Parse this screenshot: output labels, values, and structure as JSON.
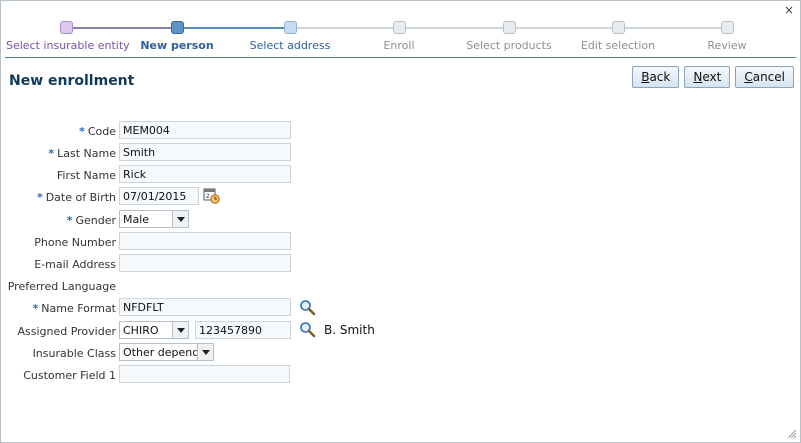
{
  "window": {
    "close_glyph": "×"
  },
  "train": {
    "steps": [
      {
        "label": "Select insurable entity",
        "state": "visited"
      },
      {
        "label": "New person",
        "state": "current"
      },
      {
        "label": "Select address",
        "state": "next"
      },
      {
        "label": "Enroll",
        "state": "pending"
      },
      {
        "label": "Select products",
        "state": "pending"
      },
      {
        "label": "Edit selection",
        "state": "pending"
      },
      {
        "label": "Review",
        "state": "pending"
      }
    ]
  },
  "page": {
    "title": "New enrollment"
  },
  "buttons": {
    "back": {
      "mnemonic": "B",
      "rest": "ack"
    },
    "next": {
      "mnemonic": "N",
      "rest": "ext"
    },
    "cancel": {
      "mnemonic": "C",
      "rest": "ancel"
    }
  },
  "form": {
    "required_marker": "*",
    "code": {
      "label": "Code",
      "value": "MEM004"
    },
    "last_name": {
      "label": "Last Name",
      "value": "Smith"
    },
    "first_name": {
      "label": "First Name",
      "value": "Rick"
    },
    "dob": {
      "label": "Date of Birth",
      "value": "07/01/2015"
    },
    "gender": {
      "label": "Gender",
      "value": "Male"
    },
    "phone": {
      "label": "Phone Number",
      "value": ""
    },
    "email": {
      "label": "E-mail Address",
      "value": ""
    },
    "language": {
      "label": "Preferred Language"
    },
    "name_format": {
      "label": "Name Format",
      "value": "NFDFLT"
    },
    "provider": {
      "label": "Assigned Provider",
      "type_value": "CHIRO",
      "id_value": "123457890",
      "name": "B. Smith"
    },
    "insurable_class": {
      "label": "Insurable Class",
      "value": "Other depende"
    },
    "customer_field_1": {
      "label": "Customer Field 1",
      "value": ""
    }
  },
  "colors": {
    "title": "#0f3a5a",
    "required": "#1f6fb5",
    "current_step": "#2f5f9c",
    "visited_step": "#7b4fa6"
  },
  "icons": [
    "close-icon",
    "calendar-icon",
    "search-icon",
    "dropdown-arrow-icon",
    "resize-grip-icon"
  ]
}
